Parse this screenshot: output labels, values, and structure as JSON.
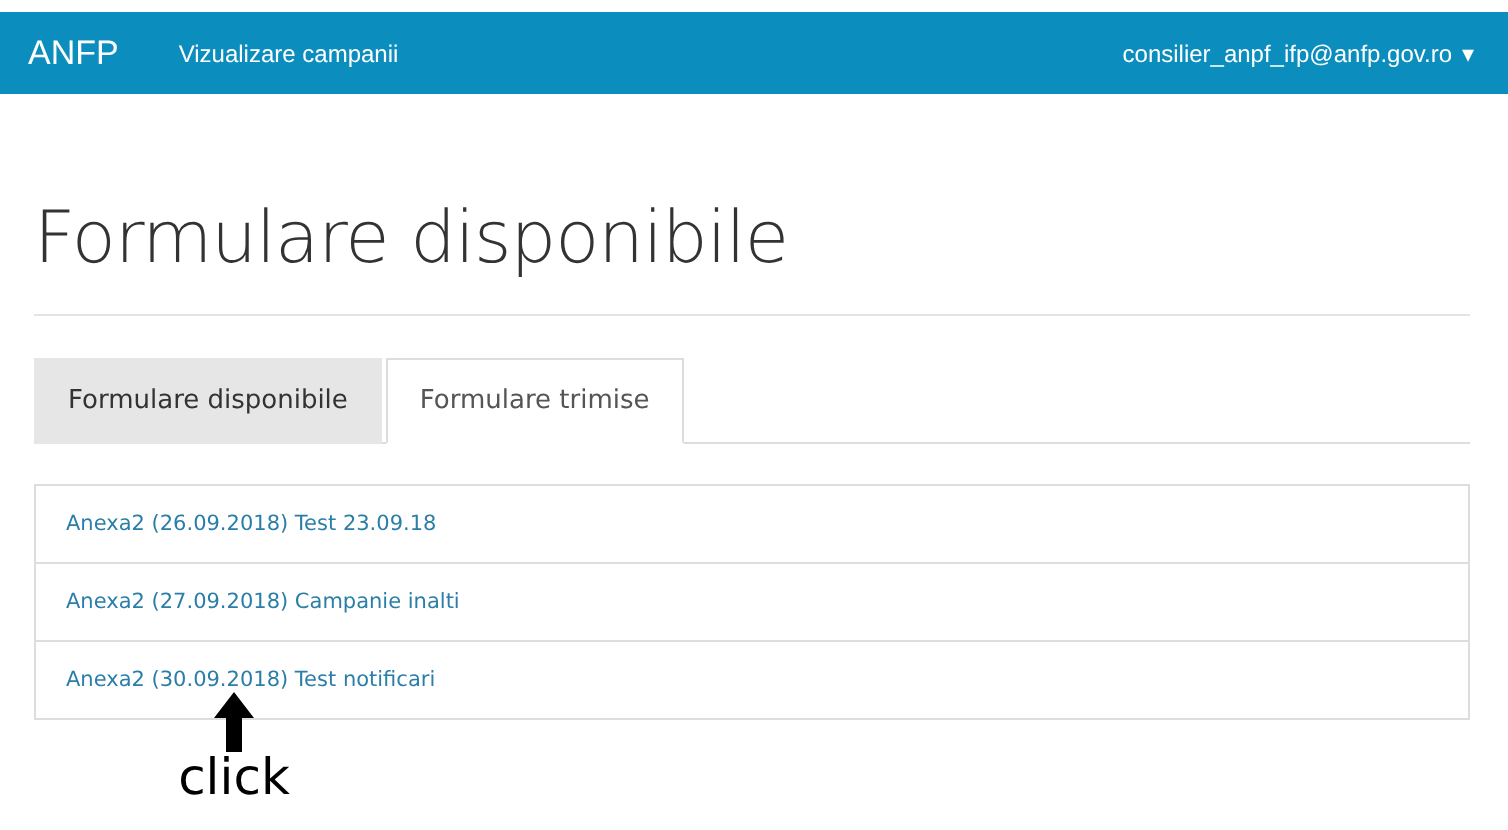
{
  "navbar": {
    "brand": "ANFP",
    "links": [
      "Vizualizare campanii"
    ],
    "user": "consilier_anpf_ifp@anfp.gov.ro",
    "user_caret": "▾"
  },
  "heading": "Formulare disponibile",
  "tabs": [
    {
      "label": "Formulare disponibile",
      "selected": false
    },
    {
      "label": "Formulare trimise",
      "selected": true
    }
  ],
  "forms": [
    "Anexa2 (26.09.2018) Test 23.09.18",
    "Anexa2 (27.09.2018) Campanie inalti",
    "Anexa2 (30.09.2018) Test notificari"
  ],
  "annotation": {
    "label": "click"
  }
}
